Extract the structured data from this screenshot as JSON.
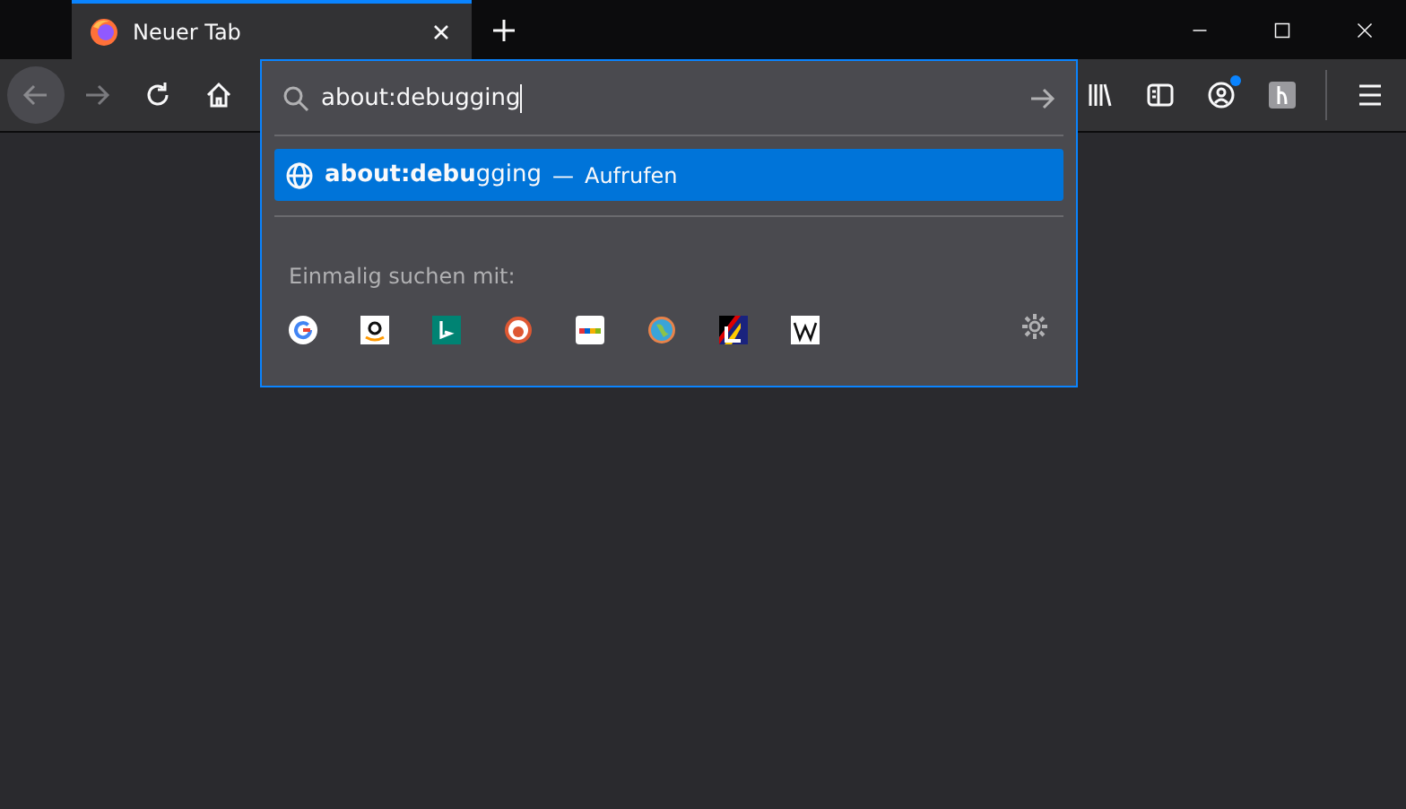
{
  "tabs": [
    {
      "title": "Neuer Tab",
      "selected": true
    }
  ],
  "toolbar": {
    "back_disabled": false,
    "forward_disabled": true,
    "account_badge": true
  },
  "urlbar": {
    "value": "about:debugging"
  },
  "results": [
    {
      "title": "**about:debu**gging",
      "separator": "—",
      "action": "Aufrufen",
      "selected": true
    }
  ],
  "one_off": {
    "label": "Einmalig suchen mit:",
    "engines": [
      {
        "kind": "google"
      },
      {
        "kind": "amazon"
      },
      {
        "kind": "bing"
      },
      {
        "kind": "duckduckgo"
      },
      {
        "kind": "ebay"
      },
      {
        "kind": "globe"
      },
      {
        "kind": "dictionary"
      },
      {
        "kind": "wikipedia"
      }
    ]
  }
}
